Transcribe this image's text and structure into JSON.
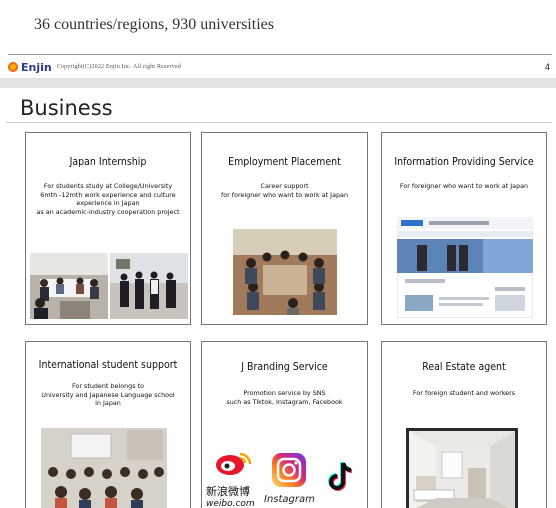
{
  "slide_top": {
    "headline": "36 countries/regions, 930 universities",
    "brand": "Enjin",
    "copyright": "Copyright(C)2022 Enjin Inc. All right Reserved",
    "page_number": "4"
  },
  "slide": {
    "title": "Business",
    "cards": [
      {
        "title": "Japan Internship",
        "lines": [
          "For students study at College/University",
          "6mth -12mth work experience and culture",
          "experience in Japan",
          "as an academic-industry cooperation project"
        ]
      },
      {
        "title": "Employment Placement",
        "lines": [
          "Career support",
          "for foreigner who want to work at Japan"
        ]
      },
      {
        "title": "Information Providing Service",
        "lines": [
          "For foreigner who want to work at Japan"
        ]
      },
      {
        "title": "International student support",
        "lines": [
          "For student belongs to",
          "University and Japanese Language school",
          "in Japan"
        ]
      },
      {
        "title": "J Branding Service",
        "lines": [
          "Promotion service by SNS",
          "such as Tiktok, Instagram, Facebook"
        ]
      },
      {
        "title": "Real Estate agent",
        "lines": [
          "For foreign student and workers"
        ]
      }
    ],
    "sns": {
      "weibo_cn": "新浪微博",
      "weibo_url": "weibo.com",
      "instagram": "Instagram"
    }
  }
}
